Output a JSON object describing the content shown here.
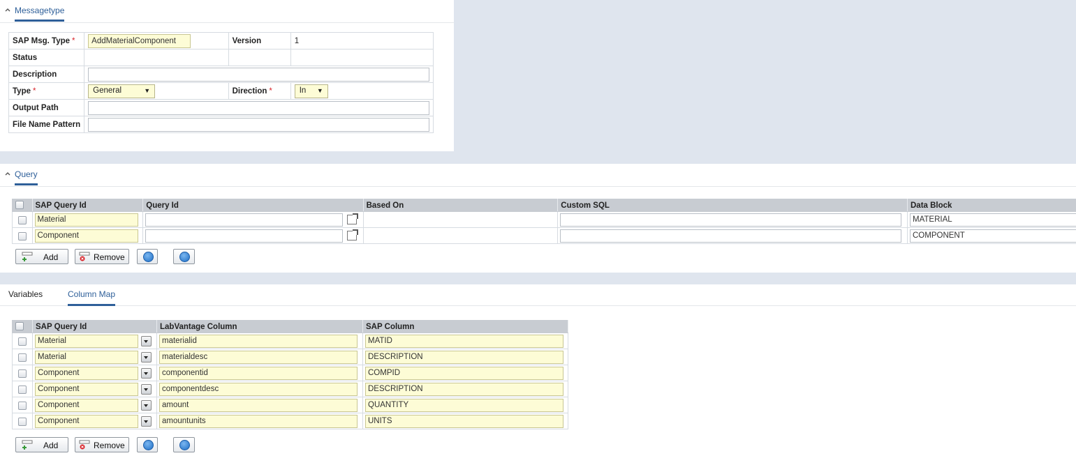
{
  "messagetype": {
    "title": "Messagetype",
    "fields": {
      "sap_msg_type_label": "SAP Msg. Type",
      "sap_msg_type_value": "AddMaterialComponent",
      "version_label": "Version",
      "version_value": "1",
      "status_label": "Status",
      "description_label": "Description",
      "description_value": "",
      "type_label": "Type",
      "type_value": "General",
      "direction_label": "Direction",
      "direction_value": "In",
      "output_path_label": "Output Path",
      "output_path_value": "",
      "file_name_pattern_label": "File Name Pattern",
      "file_name_pattern_value": "",
      "required_mark": "*"
    }
  },
  "query": {
    "title": "Query",
    "columns": [
      "SAP Query Id",
      "Query Id",
      "Based On",
      "Custom SQL",
      "Data Block"
    ],
    "rows": [
      {
        "sap_query_id": "Material",
        "query_id": "",
        "based_on": "",
        "custom_sql": "",
        "data_block": "MATERIAL"
      },
      {
        "sap_query_id": "Component",
        "query_id": "",
        "based_on": "",
        "custom_sql": "",
        "data_block": "COMPONENT"
      }
    ],
    "add_label": "Add",
    "remove_label": "Remove"
  },
  "tabs": {
    "variables": "Variables",
    "column_map": "Column Map",
    "active": "Column Map"
  },
  "column_map": {
    "columns": [
      "SAP Query Id",
      "LabVantage Column",
      "SAP Column"
    ],
    "rows": [
      {
        "sap_query_id": "Material",
        "labvantage_column": "materialid",
        "sap_column": "MATID"
      },
      {
        "sap_query_id": "Material",
        "labvantage_column": "materialdesc",
        "sap_column": "DESCRIPTION"
      },
      {
        "sap_query_id": "Component",
        "labvantage_column": "componentid",
        "sap_column": "COMPID"
      },
      {
        "sap_query_id": "Component",
        "labvantage_column": "componentdesc",
        "sap_column": "DESCRIPTION"
      },
      {
        "sap_query_id": "Component",
        "labvantage_column": "amount",
        "sap_column": "QUANTITY"
      },
      {
        "sap_query_id": "Component",
        "labvantage_column": "amountunits",
        "sap_column": "UNITS"
      }
    ],
    "add_label": "Add",
    "remove_label": "Remove"
  },
  "colors": {
    "accent": "#2e5f99",
    "required": "#d9242a",
    "input_highlight": "#fdfcd6",
    "header_bg": "#c8ccd2",
    "page_bg": "#dfe5ee"
  },
  "icons": [
    "chevron-up-icon",
    "lookup-icon",
    "dropdown-arrow-icon",
    "add-icon",
    "remove-icon",
    "move-up-icon",
    "move-down-icon"
  ]
}
